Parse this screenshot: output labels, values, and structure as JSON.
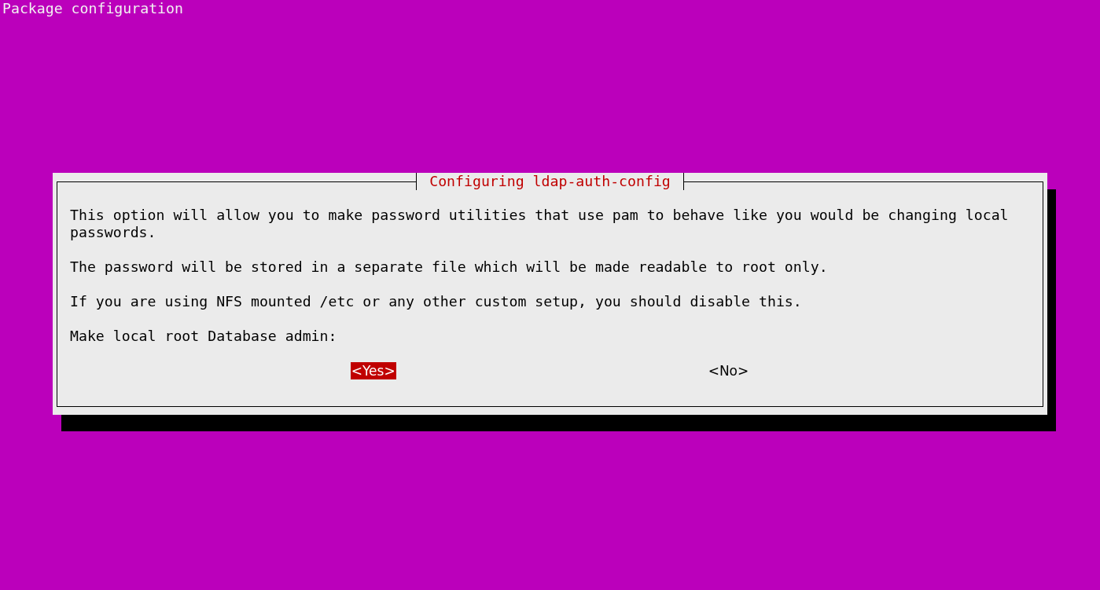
{
  "screen_title": "Package configuration",
  "dialog": {
    "title": "Configuring ldap-auth-config",
    "paragraphs": [
      "This option will allow you to make password utilities that use pam to behave like you would be changing local passwords.",
      "The password will be stored in a separate file which will be made readable to root only.",
      "If you are using NFS mounted /etc or any other custom setup, you should disable this."
    ],
    "prompt": "Make local root Database admin:",
    "buttons": [
      {
        "label": "<Yes>",
        "selected": true
      },
      {
        "label": "<No>",
        "selected": false
      }
    ]
  }
}
